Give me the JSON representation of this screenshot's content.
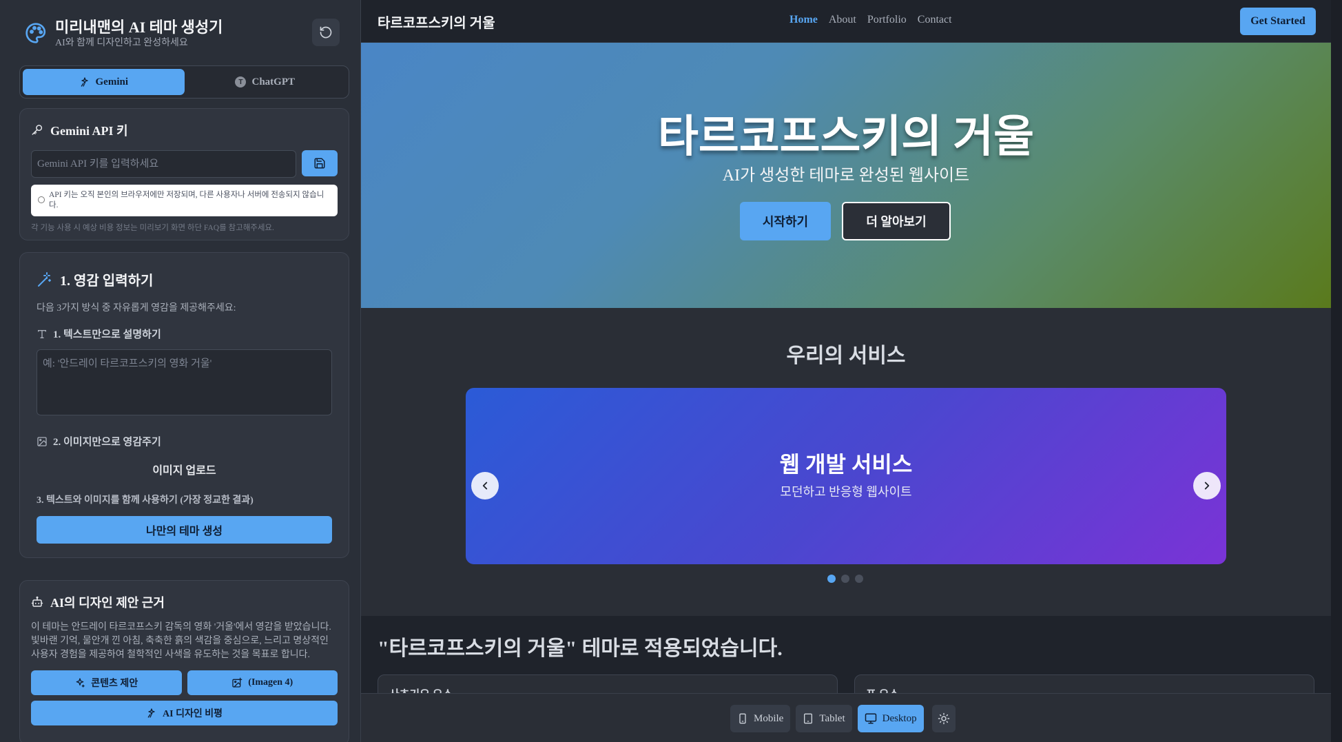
{
  "sidebar": {
    "title": "미리내맨의 AI 테마 생성기",
    "subtitle": "AI와 함께 디자인하고 완성하세요",
    "ai_tabs": [
      {
        "label": "Gemini",
        "active": true
      },
      {
        "label": "ChatGPT",
        "active": false,
        "badge": "T"
      }
    ],
    "api": {
      "heading": "Gemini API 키",
      "placeholder": "Gemini API 키를 입력하세요",
      "note": "API 키는 오직 본인의 브라우저에만 저장되며, 다른 사용자나 서버에 전송되지 않습니다.",
      "hint": "각 기능 사용 시 예상 비용 정보는 미리보기 화면 하단 FAQ를 참고해주세요."
    },
    "inspiration": {
      "heading": "1. 영감 입력하기",
      "description": "다음 3가지 방식 중 자유롭게 영감을 제공해주세요:",
      "text_label": "1. 텍스트만으로 설명하기",
      "text_placeholder": "예: '안드레이 타르코프스키의 영화 거울'",
      "image_label": "2. 이미지만으로 영감주기",
      "upload_label": "이미지 업로드",
      "combo_label": "3. 텍스트와 이미지를 함께 사용하기 (가장 정교한 결과)",
      "generate_button": "나만의 테마 생성"
    },
    "reasoning": {
      "heading": "AI의 디자인 제안 근거",
      "text": "이 테마는 안드레이 타르코프스키 감독의 영화 '거울'에서 영감을 받았습니다. 빛바랜 기억, 물안개 낀 아침, 축축한 흙의 색감을 중심으로, 느리고 명상적인 사용자 경험을 제공하여 철학적인 사색을 유도하는 것을 목표로 합니다.",
      "content_button": "콘텐츠 제안",
      "imagen_button": "(Imagen 4)",
      "critique_button": "AI 디자인 비평"
    }
  },
  "preview": {
    "nav": {
      "brand": "타르코프스키의 거울",
      "links": [
        {
          "label": "Home",
          "active": true
        },
        {
          "label": "About",
          "active": false
        },
        {
          "label": "Portfolio",
          "active": false
        },
        {
          "label": "Contact",
          "active": false
        }
      ],
      "cta": "Get Started"
    },
    "hero": {
      "title": "타르코프스키의 거울",
      "subtitle": "AI가 생성한 테마로 완성된 웹사이트",
      "primary_button": "시작하기",
      "secondary_button": "더 알아보기"
    },
    "services": {
      "title": "우리의 서비스",
      "slide_title": "웹 개발 서비스",
      "slide_description": "모던하고 반응형 웹사이트",
      "active_slide": 1,
      "slide_count": 3
    },
    "applied": {
      "title": "\"타르코프스키의 거울\" 테마로 적용되었습니다.",
      "card1": "사초기요 오스",
      "card2": "프 오스"
    },
    "device_bar": {
      "mobile": "Mobile",
      "tablet": "Tablet",
      "desktop": "Desktop",
      "active": "Desktop"
    }
  },
  "colors": {
    "accent": "#58a6f2",
    "sidebar_bg": "#2a2f38",
    "preview_bg": "#2a2e36",
    "hero_gradient_start": "#4a86c6",
    "hero_gradient_end": "#5a7a1c",
    "carousel_gradient_start": "#2b5bd7",
    "carousel_gradient_end": "#7a33d6"
  }
}
